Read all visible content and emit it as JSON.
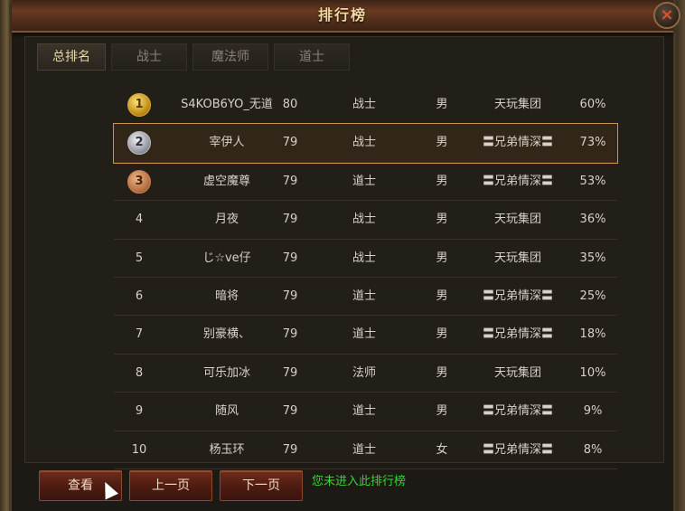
{
  "window": {
    "title": "排行榜",
    "close_label": "×"
  },
  "tabs": [
    {
      "label": "总排名",
      "active": true
    },
    {
      "label": "战士",
      "active": false
    },
    {
      "label": "魔法师",
      "active": false
    },
    {
      "label": "道士",
      "active": false
    }
  ],
  "rows": [
    {
      "rank": "1",
      "name": "S4KOB6YO_无道",
      "level": "80",
      "class": "战士",
      "sex": "男",
      "guild": "天玩集团",
      "pct": "60%"
    },
    {
      "rank": "2",
      "name": "宰伊人",
      "level": "79",
      "class": "战士",
      "sex": "男",
      "guild": "〓兄弟情深〓",
      "pct": "73%"
    },
    {
      "rank": "3",
      "name": "虚空魔尊",
      "level": "79",
      "class": "道士",
      "sex": "男",
      "guild": "〓兄弟情深〓",
      "pct": "53%"
    },
    {
      "rank": "4",
      "name": "月夜",
      "level": "79",
      "class": "战士",
      "sex": "男",
      "guild": "天玩集团",
      "pct": "36%"
    },
    {
      "rank": "5",
      "name": "じ☆ve仔",
      "level": "79",
      "class": "战士",
      "sex": "男",
      "guild": "天玩集团",
      "pct": "35%"
    },
    {
      "rank": "6",
      "name": "暗将",
      "level": "79",
      "class": "道士",
      "sex": "男",
      "guild": "〓兄弟情深〓",
      "pct": "25%"
    },
    {
      "rank": "7",
      "name": "别豪横、",
      "level": "79",
      "class": "道士",
      "sex": "男",
      "guild": "〓兄弟情深〓",
      "pct": "18%"
    },
    {
      "rank": "8",
      "name": "可乐加冰",
      "level": "79",
      "class": "法师",
      "sex": "男",
      "guild": "天玩集团",
      "pct": "10%"
    },
    {
      "rank": "9",
      "name": "随风",
      "level": "79",
      "class": "道士",
      "sex": "男",
      "guild": "〓兄弟情深〓",
      "pct": "9%"
    },
    {
      "rank": "10",
      "name": "杨玉环",
      "level": "79",
      "class": "道士",
      "sex": "女",
      "guild": "〓兄弟情深〓",
      "pct": "8%"
    }
  ],
  "buttons": {
    "view": "查看",
    "prev": "上一页",
    "next": "下一页"
  },
  "notice": "您未进入此排行榜",
  "colors": {
    "accent_border": "#c9954c",
    "notice": "#35d635",
    "close_x": "#e0502c"
  }
}
